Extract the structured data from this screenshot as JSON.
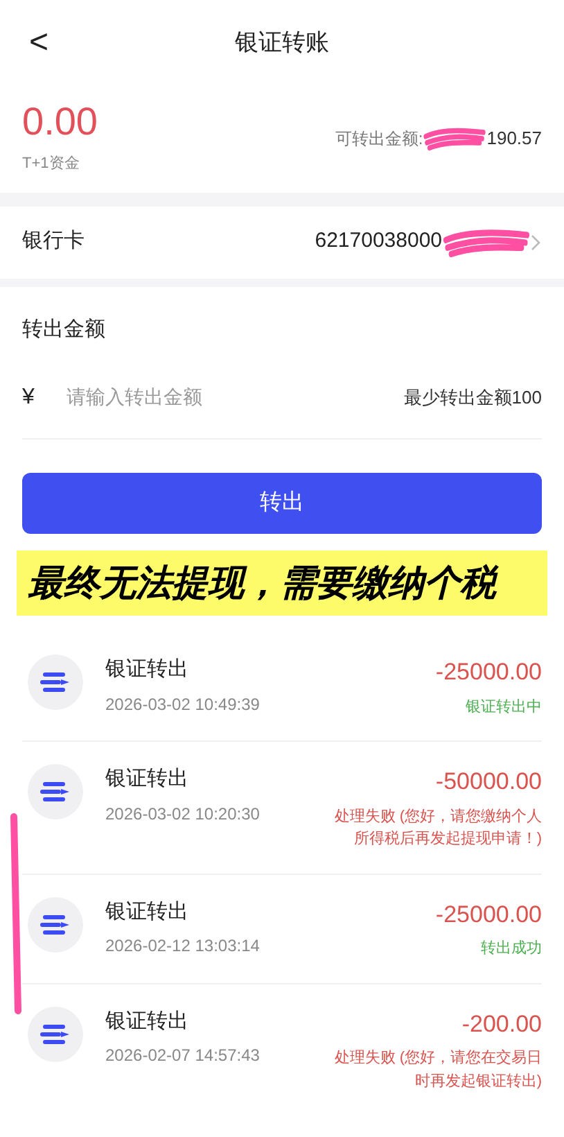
{
  "header": {
    "back": "<",
    "title": "银证转账"
  },
  "balance": {
    "amount": "0.00",
    "caption": "T+1资金",
    "available_label": "可转出金额:",
    "available_value": "190.57"
  },
  "bank_card": {
    "label": "银行卡",
    "number": "62170038000"
  },
  "form": {
    "label": "转出金额",
    "currency": "¥",
    "placeholder": "请输入转出金额",
    "min_hint": "最少转出金额100",
    "submit": "转出"
  },
  "banner": "最终无法提现，需要缴纳个税",
  "records": [
    {
      "title": "银证转出",
      "time": "2026-03-02 10:49:39",
      "amount": "-25000.00",
      "status": "银证转出中",
      "kind": "pending"
    },
    {
      "title": "银证转出",
      "time": "2026-03-02 10:20:30",
      "amount": "-50000.00",
      "status": "处理失败 (您好，请您缴纳个人所得税后再发起提现申请！)",
      "kind": "failed"
    },
    {
      "title": "银证转出",
      "time": "2026-02-12 13:03:14",
      "amount": "-25000.00",
      "status": "转出成功",
      "kind": "success"
    },
    {
      "title": "银证转出",
      "time": "2026-02-07 14:57:43",
      "amount": "-200.00",
      "status": "处理失败 (您好，请您在交易日时再发起银证转出)",
      "kind": "failed"
    }
  ]
}
